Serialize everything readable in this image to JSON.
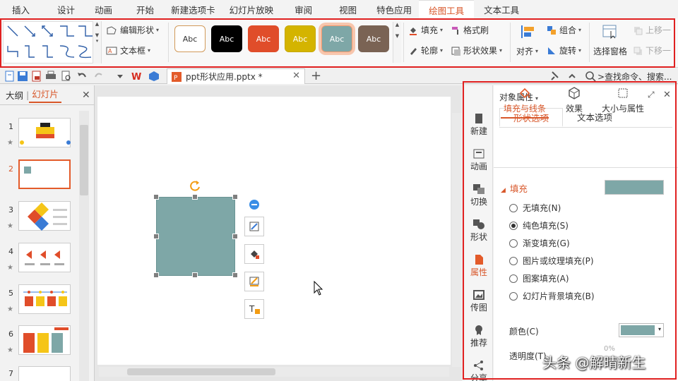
{
  "menu": {
    "tabs": [
      "插入",
      "设计",
      "动画",
      "开始",
      "新建选项卡",
      "幻灯片放映",
      "审阅",
      "视图",
      "特色应用",
      "绘图工具",
      "文本工具"
    ],
    "active": "绘图工具"
  },
  "ribbon": {
    "edit_shape": "编辑形状",
    "text_box": "文本框",
    "style_label": "Abc",
    "styles": [
      {
        "bg": "#ffffff",
        "border": "#d19a5a",
        "fg": "#333333"
      },
      {
        "bg": "#000000",
        "border": "#000000",
        "fg": "#ffffff"
      },
      {
        "bg": "#e04d2a",
        "border": "#e04d2a",
        "fg": "#ffffff"
      },
      {
        "bg": "#d4b400",
        "border": "#c6a800",
        "fg": "#ffffff"
      },
      {
        "bg": "#7ea7a7",
        "border": "#f29a6e",
        "fg": "#ffffff"
      },
      {
        "bg": "#7a6354",
        "border": "#7a6354",
        "fg": "#ffffff"
      }
    ],
    "fill": "填充",
    "format_painter": "格式刷",
    "outline": "轮廓",
    "shape_effect": "形状效果",
    "align": "对齐",
    "group": "组合",
    "rotate": "旋转",
    "selection_pane": "选择窗格",
    "bring_forward": "上移一",
    "send_backward": "下移一"
  },
  "toolbar": {
    "doc_tab": "ppt形状应用.pptx *",
    "search": ">查找命令、搜索..."
  },
  "left_panel": {
    "outline_tab": "大纲",
    "slides_tab": "幻灯片",
    "slides": [
      "1",
      "2",
      "3",
      "4",
      "5",
      "6",
      "7"
    ],
    "active_slide": "2"
  },
  "sidebar": {
    "items": [
      "新建",
      "动画",
      "切换",
      "形状",
      "属性",
      "传图",
      "推荐",
      "分享"
    ],
    "active": "属性"
  },
  "properties": {
    "title": "对象属性",
    "tab_shape": "形状选项",
    "tab_text": "文本选项",
    "sub_fill_line": "填充与线条",
    "sub_effect": "效果",
    "sub_size": "大小与属性",
    "section_fill": "填充",
    "fill_color": "#7ea7a7",
    "options": [
      "无填充(N)",
      "纯色填充(S)",
      "渐变填充(G)",
      "图片或纹理填充(P)",
      "图案填充(A)",
      "幻灯片背景填充(B)"
    ],
    "selected_option": "纯色填充(S)",
    "color_label": "颜色(C)",
    "transparency_label": "透明度(T)",
    "transparency_value": "0%"
  },
  "watermark": "头条 @解晴新生"
}
